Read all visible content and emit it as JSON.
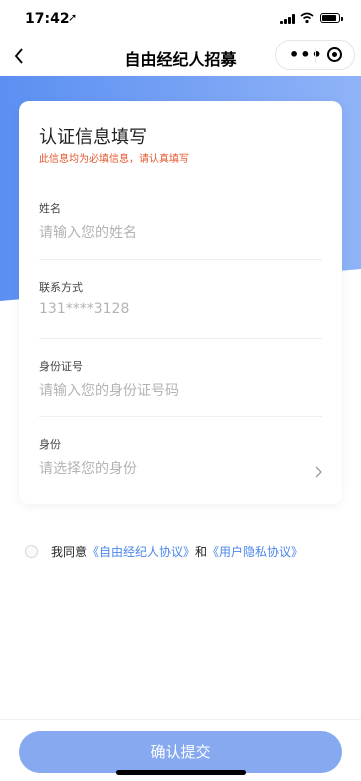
{
  "status_bar": {
    "time": "17:42",
    "location_icon": "location-arrow-icon"
  },
  "nav": {
    "title": "自由经纪人招募",
    "more_icon": "more-dots-icon",
    "close_icon": "target-icon"
  },
  "form": {
    "title": "认证信息填写",
    "subtitle": "此信息均为必填信息，请认真填写",
    "fields": [
      {
        "label": "姓名",
        "placeholder": "请输入您的姓名"
      },
      {
        "label": "联系方式",
        "value": "131****3128"
      },
      {
        "label": "身份证号",
        "placeholder": "请输入您的身份证号码"
      },
      {
        "label": "身份",
        "placeholder": "请选择您的身份"
      }
    ]
  },
  "agreement": {
    "prefix": "我同意",
    "link1": "《自由经纪人协议》",
    "middle": "和",
    "link2": "《用户隐私协议》",
    "checked": false
  },
  "submit_label": "确认提交",
  "colors": {
    "accent": "#5b8ff2",
    "button": "#86a9f0",
    "link": "#4a86e8",
    "warning": "#e4572e"
  }
}
